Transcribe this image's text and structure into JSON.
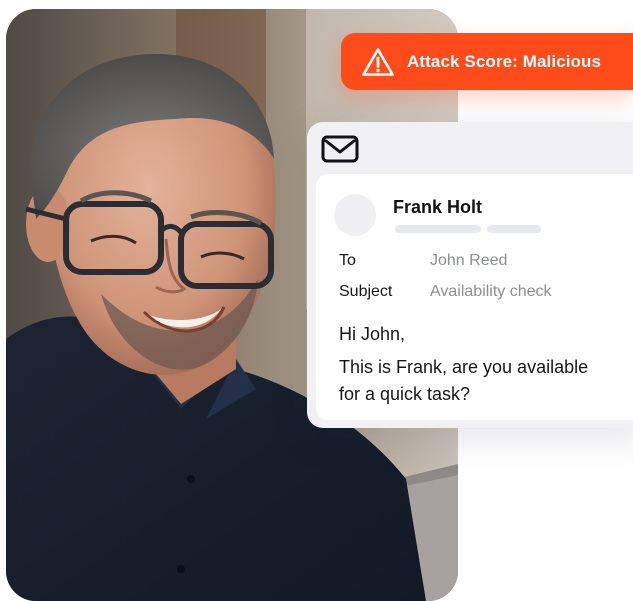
{
  "alert": {
    "icon": "warning-triangle-icon",
    "text": "Attack Score: Malicious",
    "color": "#ff4a1a"
  },
  "email": {
    "icon": "envelope-icon",
    "sender": "Frank Holt",
    "to_label": "To",
    "to_value": "John Reed",
    "subject_label": "Subject",
    "subject_value": "Availability check",
    "greeting": "Hi John,",
    "body_line_1": "This is Frank, are you available",
    "body_line_2": "for a quick task?"
  },
  "photo": {
    "subject": "man-with-glasses-photo"
  }
}
